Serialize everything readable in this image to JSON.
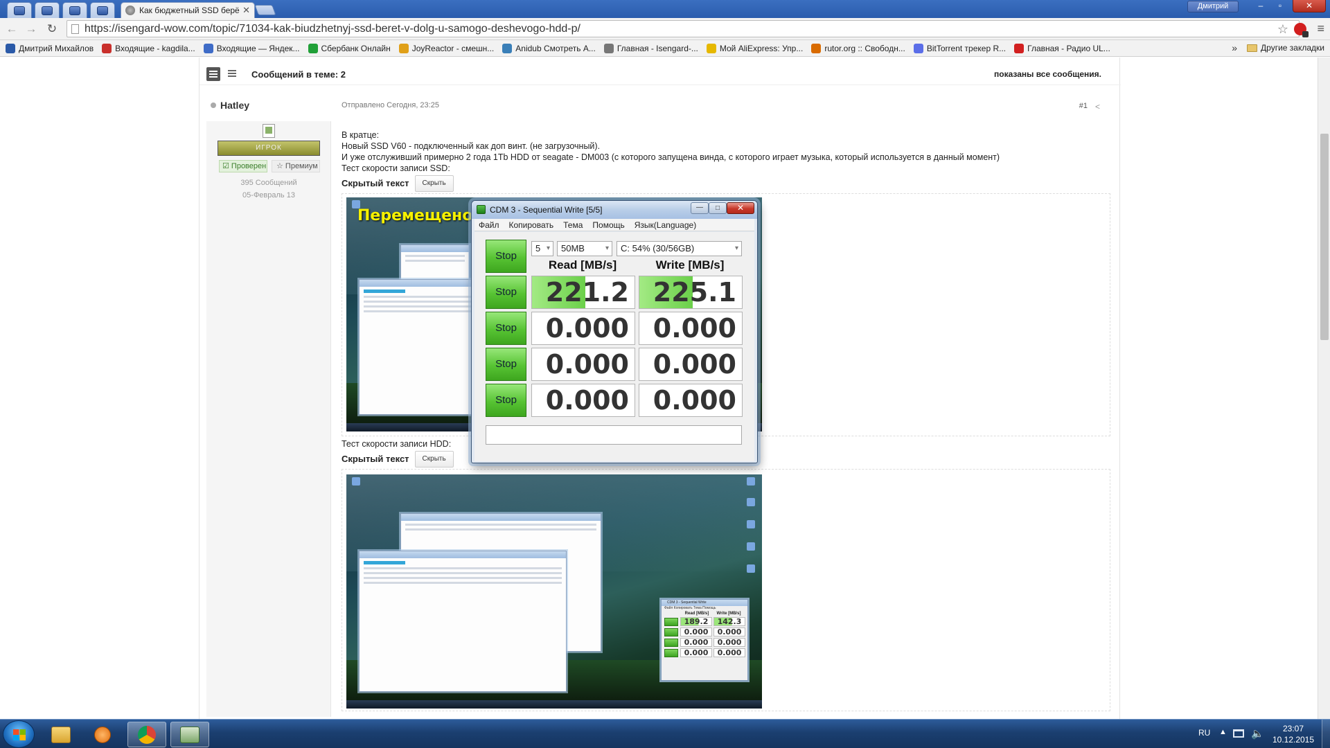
{
  "browser": {
    "active_tab_title": "Как бюджетный SSD берё",
    "url": "https://isengard-wow.com/topic/71034-kak-biudzhetnyj-ssd-beret-v-dolg-u-samogo-deshevogo-hdd-p/",
    "profile_name": "Дмитрий",
    "window_controls": {
      "minimize": "–",
      "maximize": "▫",
      "close": "✕"
    },
    "nav": {
      "back": "←",
      "forward": "→",
      "reload": "↻",
      "star": "☆",
      "menu": "≡"
    },
    "bookmarks": [
      {
        "label": "Дмитрий Михайлов",
        "icon_color": "#2b5aa8"
      },
      {
        "label": "Входящие - kagdila...",
        "icon_color": "#c9302c"
      },
      {
        "label": "Входящие — Яндек...",
        "icon_color": "#3f6cc7"
      },
      {
        "label": "Сбербанк Онлайн",
        "icon_color": "#21a038"
      },
      {
        "label": "JoyReactor - смешн...",
        "icon_color": "#e0a019"
      },
      {
        "label": "Anidub Смотреть А...",
        "icon_color": "#3a7fb8"
      },
      {
        "label": "Главная - Isengard-...",
        "icon_color": "#777777"
      },
      {
        "label": "Мой AliExpress: Упр...",
        "icon_color": "#e6b800"
      },
      {
        "label": "rutor.org :: Свободн...",
        "icon_color": "#d96b00"
      },
      {
        "label": "BitTorrent трекер R...",
        "icon_color": "#5b6ee8"
      },
      {
        "label": "Главная - Радио UL...",
        "icon_color": "#d22020"
      }
    ],
    "bookmarks_more": "»",
    "other_bookmarks": "Другие закладки"
  },
  "topic": {
    "message_count": "Сообщений в теме: 2",
    "shown_status": "показаны все сообщения."
  },
  "post": {
    "author": "Hatley",
    "date": "Отправлено Сегодня, 23:25",
    "number": "#1",
    "rank": "ИГРОК",
    "verified": "☑ Проверен",
    "premium": "☆ Премиум",
    "post_count": "395 Сообщений",
    "joined": "05-Февраль 13",
    "body": {
      "line1": "В кратце:",
      "line2": "Новый SSD V60 - подключенный как доп винт. (не загрузочный).",
      "line3": "И уже отслуживший примерно 2 года 1Tb HDD от seagate - DM003 (с которого запущена винда, с которого играет музыка, который используется в данный момент)",
      "line4": "Тест скорости записи SSD:",
      "line5": "Тест скорости записи HDD:"
    },
    "spoiler_label": "Скрытый текст",
    "spoiler_button": "Скрыть",
    "screenshot1_caption": "Перемещено 0"
  },
  "cdm_main": {
    "title": "CDM 3 - Sequential Write [5/5]",
    "menu": [
      "Файл",
      "Копировать",
      "Тема",
      "Помощь",
      "Язык(Language)"
    ],
    "count": "5",
    "size": "50MB",
    "drive": "C: 54% (30/56GB)",
    "read_header": "Read [MB/s]",
    "write_header": "Write [MB/s]",
    "stop_label": "Stop",
    "rows": [
      {
        "read": "221.2",
        "write": "225.1"
      },
      {
        "read": "0.000",
        "write": "0.000"
      },
      {
        "read": "0.000",
        "write": "0.000"
      },
      {
        "read": "0.000",
        "write": "0.000"
      }
    ]
  },
  "cdm_mini": {
    "title": "CDM 3 - Sequential Write",
    "menu": "Файл  Копировать  Тема  Помощь",
    "read_header": "Read [MB/s]",
    "write_header": "Write [MB/s]",
    "rows": [
      {
        "read": "189.2",
        "write": "142.3"
      },
      {
        "read": "0.000",
        "write": "0.000"
      },
      {
        "read": "0.000",
        "write": "0.000"
      },
      {
        "read": "0.000",
        "write": "0.000"
      }
    ]
  },
  "taskbar": {
    "lang": "RU",
    "time": "23:07",
    "date": "10.12.2015",
    "tray_arrow": "▲",
    "volume_icon": "🔈"
  }
}
